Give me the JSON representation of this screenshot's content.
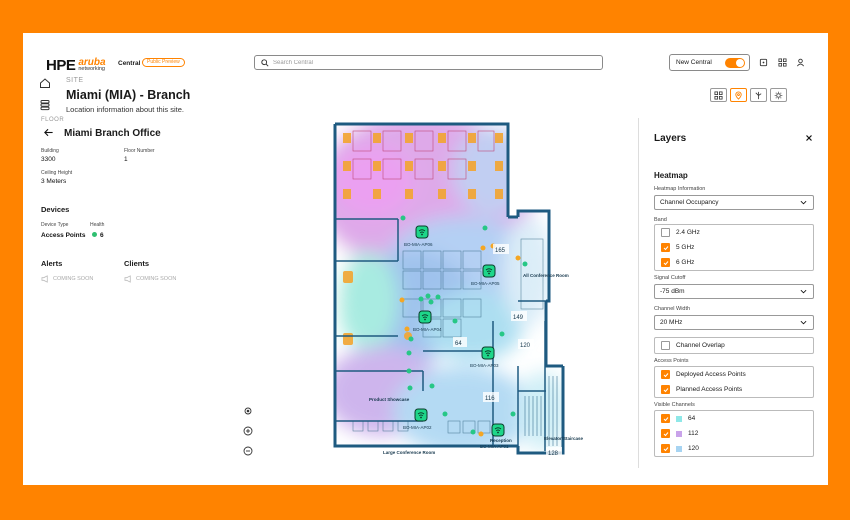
{
  "header": {
    "brand_hpe": "HPE",
    "brand_aruba": "aruba",
    "brand_networking": "networking",
    "app_name": "Central",
    "preview_badge": "Public Preview",
    "search_placeholder": "Search Central",
    "new_central_label": "New Central",
    "new_central_on": true
  },
  "site": {
    "label": "SITE",
    "title": "Miami (MIA) - Branch",
    "subtitle": "Location information about this site."
  },
  "floor": {
    "label": "FLOOR",
    "title": "Miami Branch Office",
    "building_label": "Building",
    "building_value": "3300",
    "floor_number_label": "Floor Number",
    "floor_number_value": "1",
    "ceiling_label": "Ceiling Height",
    "ceiling_value": "3 Meters"
  },
  "devices": {
    "title": "Devices",
    "col_type": "Device Type",
    "col_health": "Health",
    "row_type": "Access Points",
    "row_count": "6"
  },
  "alerts": {
    "title": "Alerts",
    "status": "COMING SOON"
  },
  "clients": {
    "title": "Clients",
    "status": "COMING SOON"
  },
  "map": {
    "rooms": [
      "All Conference Room",
      "Product Showcase",
      "Large Conference Room",
      "Reception",
      "Elevator/Staircase"
    ],
    "aps": [
      "BO-MIA-AP06",
      "BO-MIA-AP05",
      "BO-MIA-AP04",
      "BO-MIA-AP03",
      "BO-MIA-AP02",
      "BO-MIA-AP01"
    ],
    "channel_labels": [
      "165",
      "149",
      "64",
      "120",
      "116",
      "128"
    ]
  },
  "layers": {
    "title": "Layers",
    "heatmap_title": "Heatmap",
    "heatmap_info_label": "Heatmap Information",
    "heatmap_info_value": "Channel Occupancy",
    "band_label": "Band",
    "bands": [
      {
        "label": "2.4 GHz",
        "checked": false
      },
      {
        "label": "5 GHz",
        "checked": true
      },
      {
        "label": "6 GHz",
        "checked": true
      }
    ],
    "signal_label": "Signal Cutoff",
    "signal_value": "-75 dBm",
    "width_label": "Channel Width",
    "width_value": "20 MHz",
    "overlap_label": "Channel Overlap",
    "ap_label": "Access Points",
    "ap_options": [
      {
        "label": "Deployed Access Points",
        "checked": true
      },
      {
        "label": "Planned Access Points",
        "checked": true
      }
    ],
    "visible_label": "Visible Channels",
    "channels": [
      {
        "label": "64",
        "color": "#8fe8e8",
        "checked": true
      },
      {
        "label": "112",
        "color": "#c9a3ea",
        "checked": true
      },
      {
        "label": "120",
        "color": "#a7d4f2",
        "checked": true
      }
    ]
  },
  "colors": {
    "accent": "#FF8300",
    "ap_green": "#1ed68a",
    "wall": "#1e5a80"
  }
}
